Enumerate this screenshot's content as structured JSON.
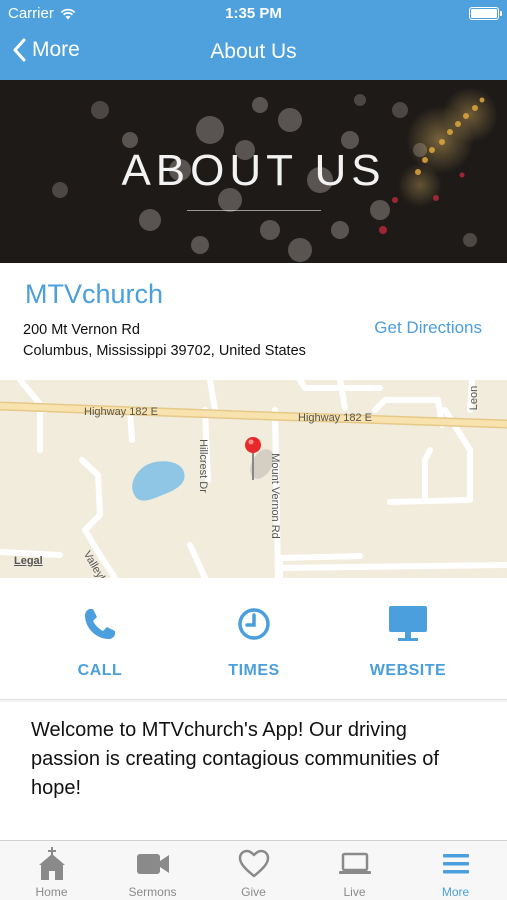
{
  "status_bar": {
    "carrier": "Carrier",
    "time": "1:35 PM"
  },
  "nav": {
    "back_label": "More",
    "title": "About Us"
  },
  "hero": {
    "title": "ABOUT US"
  },
  "church": {
    "name": "MTVchurch",
    "address_line1": "200 Mt Vernon Rd",
    "address_line2": "Columbus, Mississippi 39702, United States",
    "directions_label": "Get Directions"
  },
  "map": {
    "road_labels": {
      "highway_left": "Highway 182 E",
      "highway_right": "Highway 182 E",
      "hillcrest": "Hillcrest Dr",
      "mount_vernon": "Mount Vernon Rd",
      "valley": "Valleybro",
      "leon": "Leon"
    },
    "legal_label": "Legal"
  },
  "actions": [
    {
      "label": "CALL",
      "icon": "phone-icon"
    },
    {
      "label": "TIMES",
      "icon": "clock-icon"
    },
    {
      "label": "WEBSITE",
      "icon": "monitor-icon"
    }
  ],
  "welcome_text": "Welcome to MTVchurch's App! Our driving passion is creating contagious communities of hope!",
  "tabs": [
    {
      "label": "Home",
      "icon": "church-icon",
      "active": false
    },
    {
      "label": "Sermons",
      "icon": "video-camera-icon",
      "active": false
    },
    {
      "label": "Give",
      "icon": "heart-icon",
      "active": false
    },
    {
      "label": "Live",
      "icon": "laptop-icon",
      "active": false
    },
    {
      "label": "More",
      "icon": "menu-icon",
      "active": true
    }
  ],
  "colors": {
    "accent": "#4ea1dd",
    "link": "#4a9fdc",
    "map_bg": "#f2ecdd",
    "highway": "#f5dca0",
    "water": "#8fc6e6",
    "pin": "#e8282b"
  }
}
